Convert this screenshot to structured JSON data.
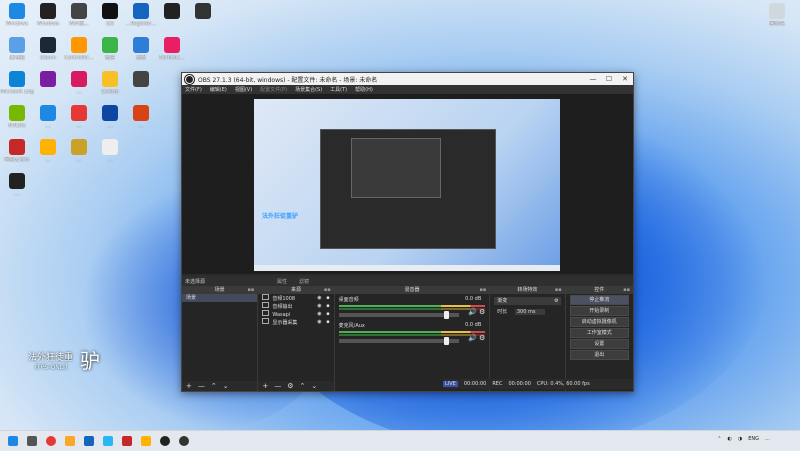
{
  "desktop": {
    "icons": [
      {
        "label": "Windows",
        "color": "#1e88e5"
      },
      {
        "label": "Windows",
        "color": "#222222"
      },
      {
        "label": "WiFi版…",
        "color": "#444444"
      },
      {
        "label": "QQ",
        "color": "#111111"
      },
      {
        "label": "…Register…",
        "color": "#1565c0"
      },
      {
        "label": "",
        "color": "#222222"
      },
      {
        "label": "",
        "color": "#333333"
      },
      {
        "label": "此电脑",
        "color": "#5aa0e6"
      },
      {
        "label": "Steam",
        "color": "#1b2838"
      },
      {
        "label": "Controller…",
        "color": "#ff9800"
      },
      {
        "label": "微信",
        "color": "#3bb54a"
      },
      {
        "label": "迅雷",
        "color": "#2e7dd7"
      },
      {
        "label": "Nahimic…",
        "color": "#e91e63"
      },
      {
        "label": "Microsoft Edge",
        "color": "#0b84d8"
      },
      {
        "label": "",
        "color": "#7b1fa2"
      },
      {
        "label": "…",
        "color": "#d81b60"
      },
      {
        "label": "QQ音乐",
        "color": "#f6c026"
      },
      {
        "label": "",
        "color": "#444444"
      },
      {
        "label": "NVIDIA",
        "color": "#76b900"
      },
      {
        "label": "…",
        "color": "#1e88e5"
      },
      {
        "label": "…",
        "color": "#e53935"
      },
      {
        "label": "…",
        "color": "#0d47a1"
      },
      {
        "label": "…",
        "color": "#d84315"
      },
      {
        "label": "网易云音乐",
        "color": "#c62828"
      },
      {
        "label": "…",
        "color": "#ffb300"
      },
      {
        "label": "…",
        "color": "#c9a227"
      },
      {
        "label": "…",
        "color": "#eeeeee"
      },
      {
        "label": "…",
        "color": "#222222"
      }
    ],
    "top_right_icon_label": "回收站",
    "overlay_text": "法外狂徒重",
    "overlay_big": "驴",
    "overlay_sub": "[FPS-ONLI]"
  },
  "obs": {
    "title": "OBS 27.1.3 (64-bit, windows) - 配置文件: 未命名 - 场景: 未命名",
    "win_controls": {
      "min": "—",
      "max": "☐",
      "close": "✕"
    },
    "menus": [
      "文件(F)",
      "编辑(E)",
      "视图(V)",
      "配置文件(P)",
      "场景集合(S)",
      "工具(T)",
      "帮助(H)"
    ],
    "scene_bar": {
      "selected": "未选择源",
      "props": "属性",
      "filters": "滤镜"
    },
    "docks": {
      "scenes": {
        "header": "场景",
        "items": [
          "场景"
        ]
      },
      "sources": {
        "header": "来源",
        "items": [
          "音频1008",
          "音频输出",
          "Wasapi",
          "显示器采集"
        ]
      },
      "mixer": {
        "header": "混音器",
        "channels": [
          {
            "name": "桌面音频",
            "db": "0.0 dB",
            "level": 0.9
          },
          {
            "name": "麦克风/Aux",
            "db": "0.0 dB",
            "level": 0.9
          }
        ]
      },
      "transitions": {
        "header": "转场特效",
        "type": "渐变",
        "duration_label": "时长",
        "duration": "300 ms"
      },
      "controls": {
        "header": "控件",
        "buttons": [
          "停止推流",
          "开始录制",
          "启动虚拟摄像机",
          "工作室模式",
          "设置",
          "退出"
        ]
      }
    },
    "status": {
      "live_tag": "LIVE",
      "live_time": "00:00:00",
      "rec_tag": "REC",
      "rec_time": "00:00:00",
      "cpu": "CPU: 0.4%, 60.00 fps"
    },
    "preview_caption": "法外狂徒重驴"
  },
  "taskbar": {
    "tray": {
      "lang": "ENG",
      "time": "…"
    }
  }
}
